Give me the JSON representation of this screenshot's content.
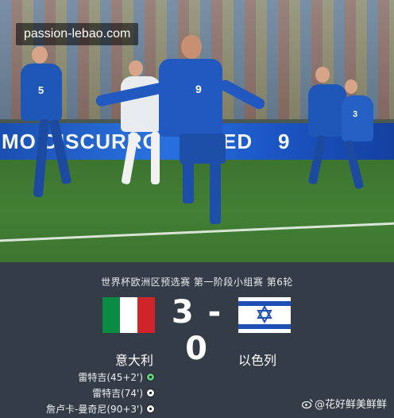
{
  "watermark": "passion-lebao.com",
  "photo": {
    "boards": [
      "MO  DISCURRO",
      "ED",
      "9"
    ],
    "jerseys": [
      "5",
      "9",
      "3"
    ]
  },
  "match": {
    "competition": "世界杯欧洲区预选赛 第一阶段小组赛 第6轮",
    "home_team": "意大利",
    "away_team": "以色列",
    "score": "3 - 0",
    "scorers": [
      {
        "text": "雷特吉(45+2')",
        "icon": "penalty-ball-icon"
      },
      {
        "text": "雷特吉(74')",
        "icon": "ball-icon"
      },
      {
        "text": "詹卢卡-曼奇尼(90+3')",
        "icon": "ball-icon"
      }
    ]
  },
  "credit": "@花好鲜美鲜鲜",
  "colors": {
    "italy_green": "#0b8c45",
    "italy_white": "#ffffff",
    "italy_red": "#d1232a",
    "israel_blue": "#1e4fb5",
    "panel_bg": "#343c47",
    "azzurri_blue": "#1f57b8"
  }
}
